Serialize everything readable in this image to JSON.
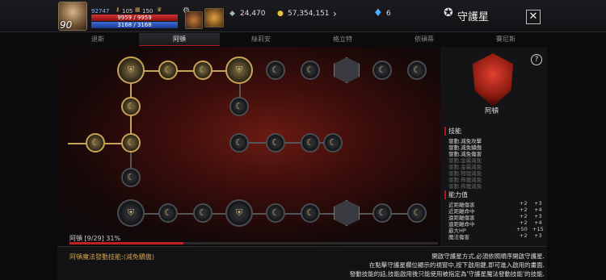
{
  "player": {
    "level": "90",
    "points": "92747",
    "keys": "105",
    "scrolls": "150",
    "hp": "9959 / 9959",
    "mp": "3168 / 3168"
  },
  "currency": {
    "crystal": "24,470",
    "gold": "57,354,151",
    "gem": "6"
  },
  "header": {
    "title": "守護星",
    "close": "✕"
  },
  "tabs": [
    "退斯",
    "阿頓",
    "絲莉安",
    "格立特",
    "依碩蒂",
    "賽尼斯"
  ],
  "board": {
    "progress_label": "阿頓 [9/29] 31%",
    "progress": 0.31
  },
  "footer": {
    "skill_text": "阿頓魔法發動技能:(減免驕傲)",
    "help": [
      "開啟守護星方式,必須依照順序開啟守護星.",
      "在點擊守護星欄位顯示的視窗中,按下啟用鍵,即可進入啟用的畫面.",
      "發動技能的話,技能啟用後只能使用被指定為'守護星魔法發動技能'的技能."
    ]
  },
  "panel": {
    "name": "阿頓",
    "skills_title": "技能",
    "stats_title": "能力值",
    "skills": [
      {
        "text": "發動.減免攻擊",
        "active": true
      },
      {
        "text": "發動.減免驕傲",
        "active": true
      },
      {
        "text": "發動.減免傷害",
        "active": true
      },
      {
        "text": "發動.金屬減免",
        "active": false
      },
      {
        "text": "發動.金屬減免",
        "active": false
      },
      {
        "text": "發動.物理減免",
        "active": false
      },
      {
        "text": "發動.佈魔減免",
        "active": false
      },
      {
        "text": "發動.佈魔減免",
        "active": false
      }
    ],
    "stats": [
      {
        "name": "近距離傷害",
        "cur": "+2",
        "next": "+3"
      },
      {
        "name": "近距離命中",
        "cur": "+2",
        "next": "+4"
      },
      {
        "name": "遠距離傷害",
        "cur": "+2",
        "next": "+3"
      },
      {
        "name": "遠距離命中",
        "cur": "+2",
        "next": "+4"
      },
      {
        "name": "最大HP",
        "cur": "+50",
        "next": "+15"
      },
      {
        "name": "魔法傷害",
        "cur": "+2",
        "next": "+3"
      }
    ]
  },
  "colors": {
    "accent": "#b01818",
    "gold": "#c9a455",
    "hp": "#c02020",
    "mp": "#3a6ad8"
  }
}
